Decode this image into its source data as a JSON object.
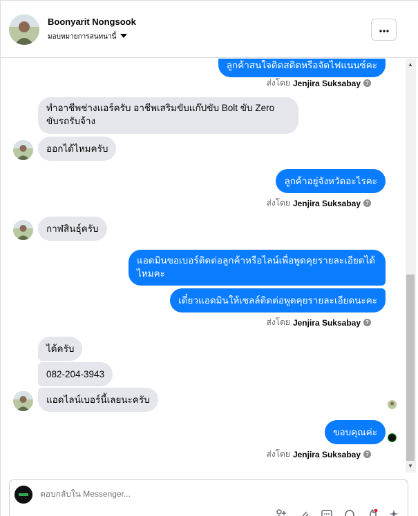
{
  "header": {
    "name": "Boonyarit Nongsook",
    "subtitle": "มอบหมายการสนทนานี้"
  },
  "messages": [
    {
      "type": "out",
      "text": "ลูกค้าสนใจติดสติดหรือจัดไฟแนนซ์คะ"
    },
    {
      "type": "sentby",
      "prefix": "ส่งโดย",
      "name": "Jenjira Suksabay"
    },
    {
      "type": "in",
      "text": "ทำอาชีพช่างแอร์ครับ อาชีพเสริมขับแก๊ปขับ Bolt ขับ Zero"
    },
    {
      "type": "in",
      "text": "ขับรถรับจ้าง"
    },
    {
      "type": "in",
      "text": "ออกได้ไหมครับ"
    },
    {
      "type": "out",
      "text": "ลูกค้าอยู่จังหวัดอะไรคะ"
    },
    {
      "type": "sentby",
      "prefix": "ส่งโดย",
      "name": "Jenjira Suksabay"
    },
    {
      "type": "in",
      "text": "กาฬสินธุ์ครับ"
    },
    {
      "type": "out",
      "text": "แอดมินขอเบอร์ติดต่อลูกค้าหรือไลน์เพื่อพูดคุยรายละเอียดได้"
    },
    {
      "type": "out",
      "text": "ไหมคะ"
    },
    {
      "type": "out",
      "text": "เดี๋ยวแอดมินให้เซลล์ติดต่อพูดคุยรายละเอียดนะคะ"
    },
    {
      "type": "sentby",
      "prefix": "ส่งโดย",
      "name": "Jenjira Suksabay"
    },
    {
      "type": "in",
      "text": "ได้ครับ"
    },
    {
      "type": "in",
      "text": "082-204-3943"
    },
    {
      "type": "in",
      "text": "แอดไลน์เบอร์นี้เลยนะครับ"
    },
    {
      "type": "out",
      "text": "ขอบคุณค่ะ"
    },
    {
      "type": "sentby",
      "prefix": "ส่งโดย",
      "name": "Jenjira Suksabay"
    }
  ],
  "composer": {
    "placeholder": "ตอบกลับใน Messenger..."
  },
  "icons": {
    "more": "more-icon",
    "info": "info-icon",
    "caret": "caret-down-icon",
    "add_contact": "add-person-icon",
    "attach": "paperclip-icon",
    "gif": "gif-icon",
    "emoji": "emoji-icon",
    "thumbs_up": "thumbs-up-icon"
  },
  "colors": {
    "outgoing_bubble": "#0a7cff",
    "incoming_bubble": "#e4e6eb"
  }
}
